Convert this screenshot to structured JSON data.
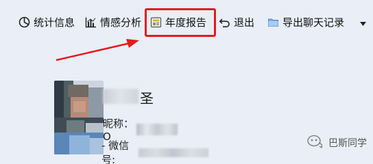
{
  "toolbar": {
    "items": [
      {
        "label": "统计信息",
        "icon": "pie-chart-icon"
      },
      {
        "label": "情感分析",
        "icon": "bar-chart-icon"
      },
      {
        "label": "年度报告",
        "icon": "report-icon"
      },
      {
        "label": "退出",
        "icon": "undo-arrow-icon"
      },
      {
        "label": "导出聊天记录",
        "icon": "folder-icon"
      }
    ],
    "dropdown_icon": "chevron-down-icon",
    "highlighted_item": "年度报告",
    "highlight_color": "#e21b1b"
  },
  "profile": {
    "name_visible_char": "圣",
    "nickname_label": "昵称：O",
    "wechat_id_label": "- 微信号:"
  },
  "watermark": {
    "text": "巴斯同学",
    "icon": "wechat-official-account-icon"
  },
  "colors": {
    "background": "#e9eef7",
    "annotation_red": "#e21b1b"
  }
}
